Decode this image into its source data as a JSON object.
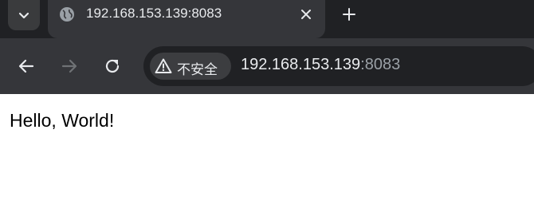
{
  "tab": {
    "title": "192.168.153.139:8083",
    "favicon_icon": "globe-icon",
    "close_icon": "close-icon"
  },
  "tab_search_icon": "chevron-down-icon",
  "new_tab_icon": "plus-icon",
  "toolbar": {
    "back_icon": "arrow-left-icon",
    "forward_icon": "arrow-right-icon",
    "reload_icon": "reload-icon"
  },
  "omnibox": {
    "security_icon": "warning-icon",
    "security_label": "不安全",
    "url_host": "192.168.153.139",
    "url_port": ":8083"
  },
  "page": {
    "text": "Hello, World!"
  },
  "colors": {
    "tabstrip": "#202124",
    "toolbar": "#35363a",
    "omnibox": "#202124",
    "chip": "#3c3d40",
    "text_light": "#e8eaed",
    "text_dim": "#9aa0a6"
  }
}
